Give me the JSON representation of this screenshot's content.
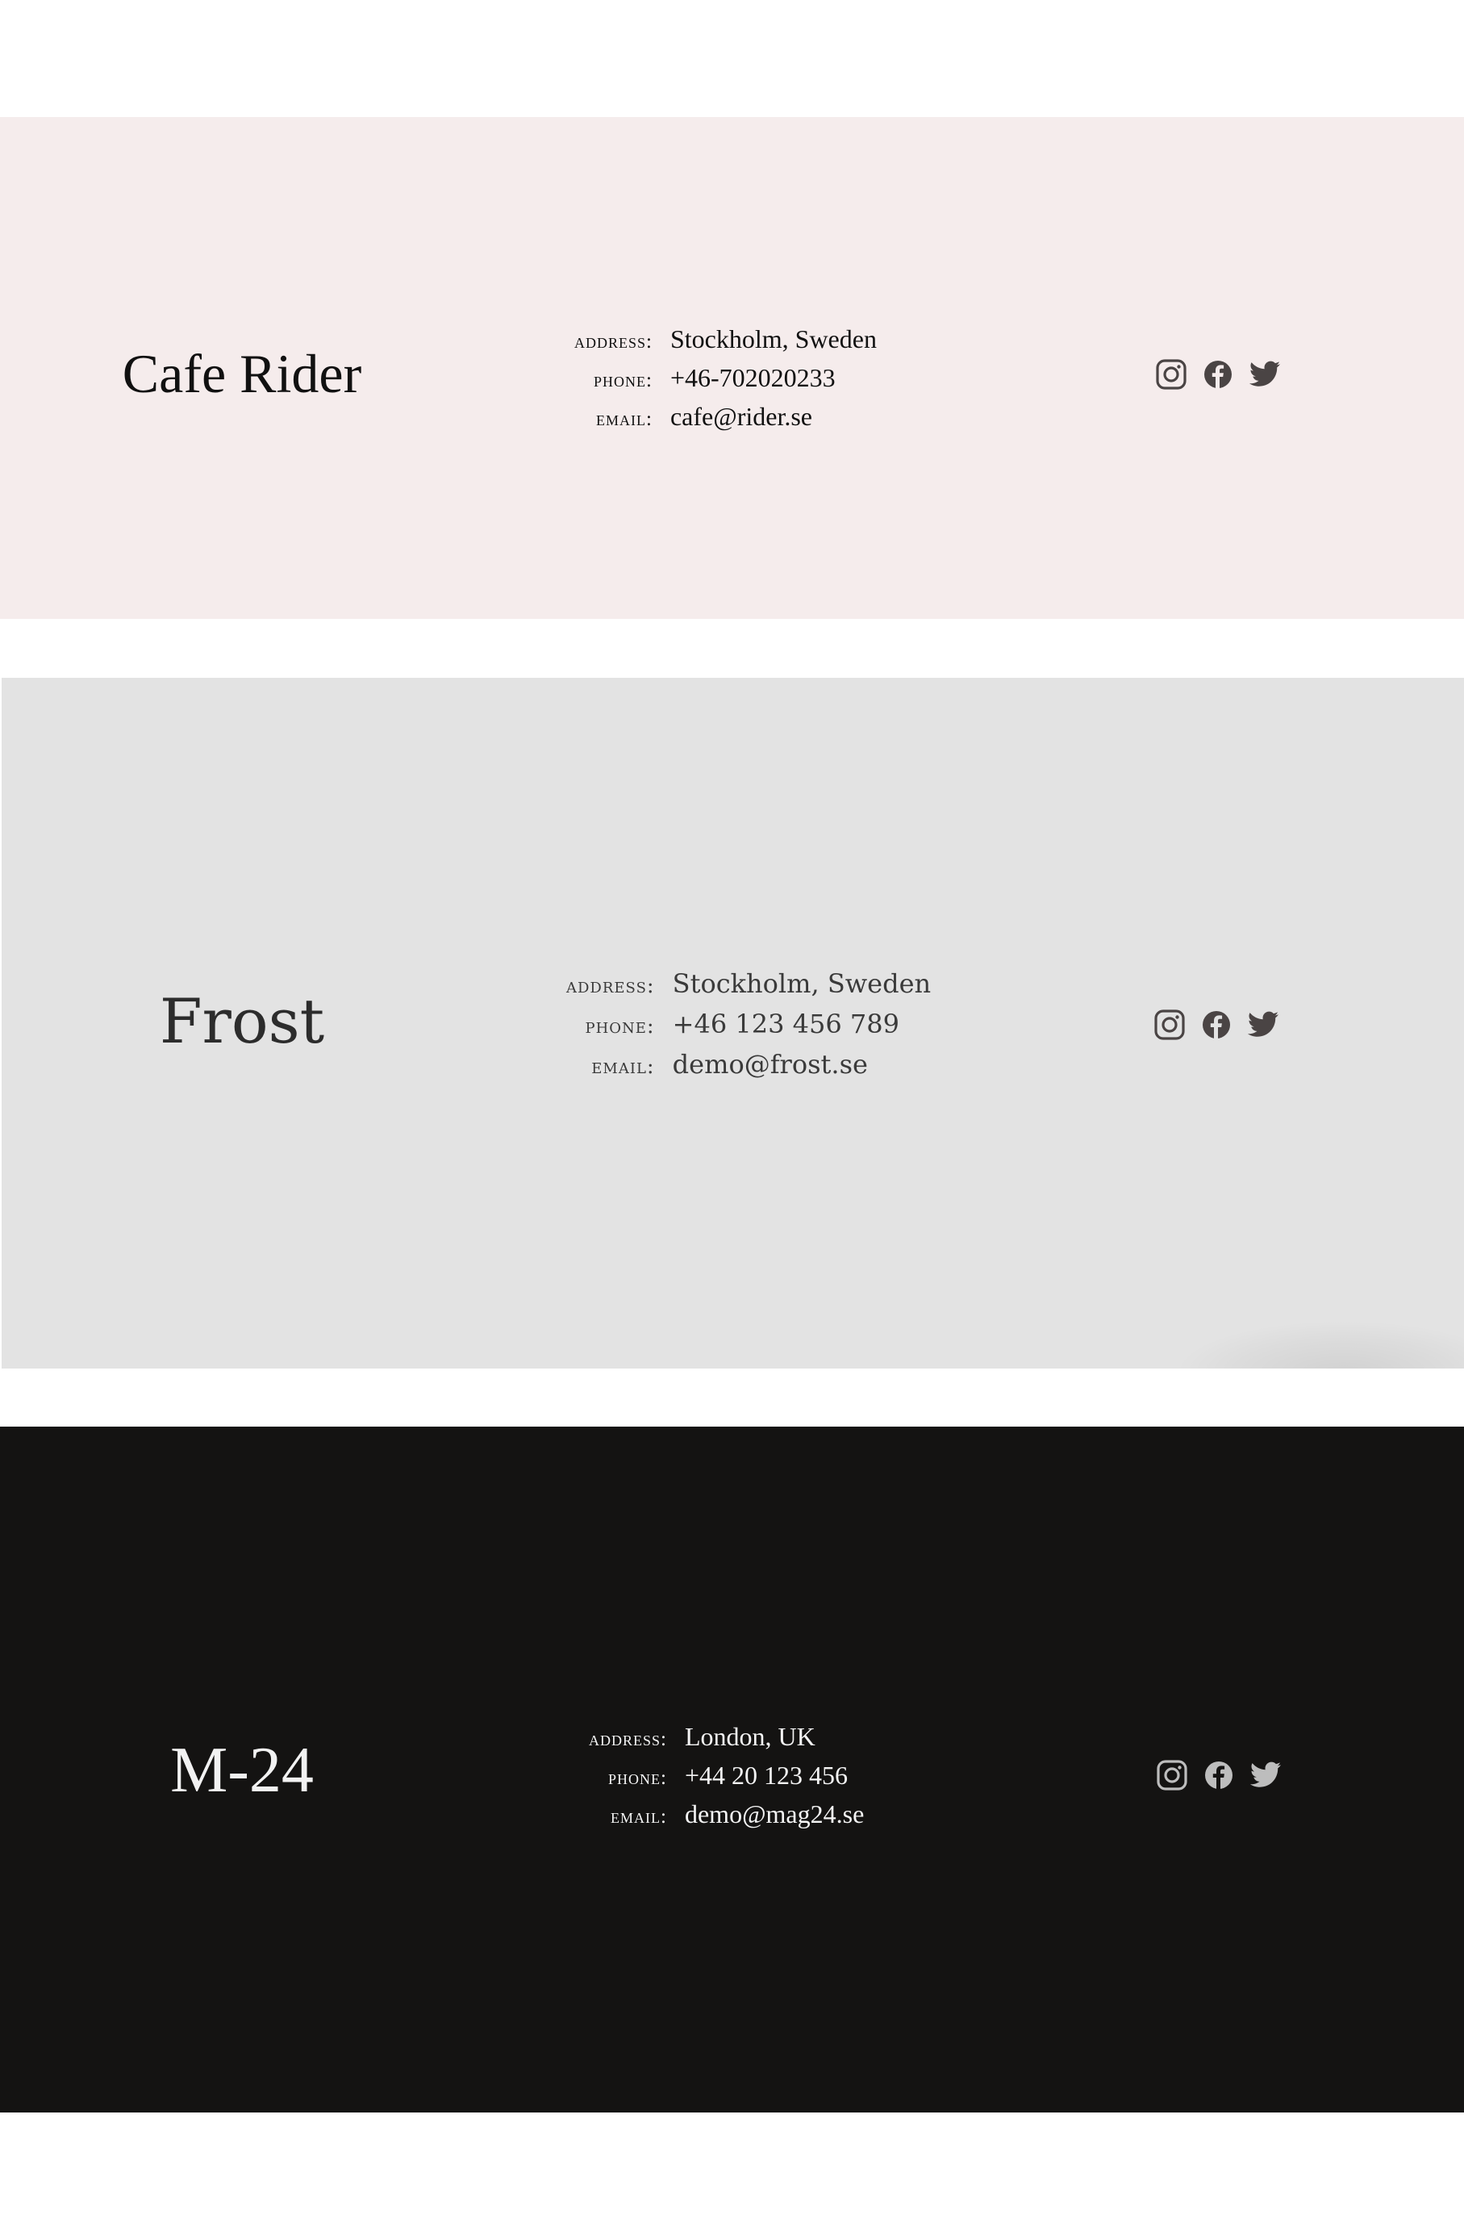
{
  "sections": [
    {
      "brand": "Cafe Rider",
      "address_label": "ADDRESS:",
      "address": "Stockholm, Sweden",
      "phone_label": "PHONE:",
      "phone": "+46-702020233",
      "email_label": "EMAIL:",
      "email": "cafe@rider.se",
      "background": "#f5ecec",
      "text_color": "#111111",
      "icon_color": "#4a4444",
      "icons": [
        "instagram-icon",
        "facebook-icon",
        "twitter-icon"
      ]
    },
    {
      "brand": "Frost",
      "address_label": "ADDRESS:",
      "address": "Stockholm, Sweden",
      "phone_label": "PHONE:",
      "phone": "+46 123 456 789",
      "email_label": "EMAIL:",
      "email": "demo@frost.se",
      "background": "#e3e3e3",
      "text_color": "#2c2c2c",
      "icon_color": "#4a4444",
      "icons": [
        "instagram-icon",
        "facebook-icon",
        "twitter-icon"
      ]
    },
    {
      "brand": "M-24",
      "address_label": "ADDRESS:",
      "address": "London, UK",
      "phone_label": "PHONE:",
      "phone": "+44 20 123 456",
      "email_label": "EMAIL:",
      "email": "demo@mag24.se",
      "background": "#141312",
      "text_color": "#f2f2f2",
      "icon_color": "#bdbdbd",
      "icons": [
        "instagram-icon",
        "facebook-icon",
        "twitter-icon"
      ]
    }
  ]
}
